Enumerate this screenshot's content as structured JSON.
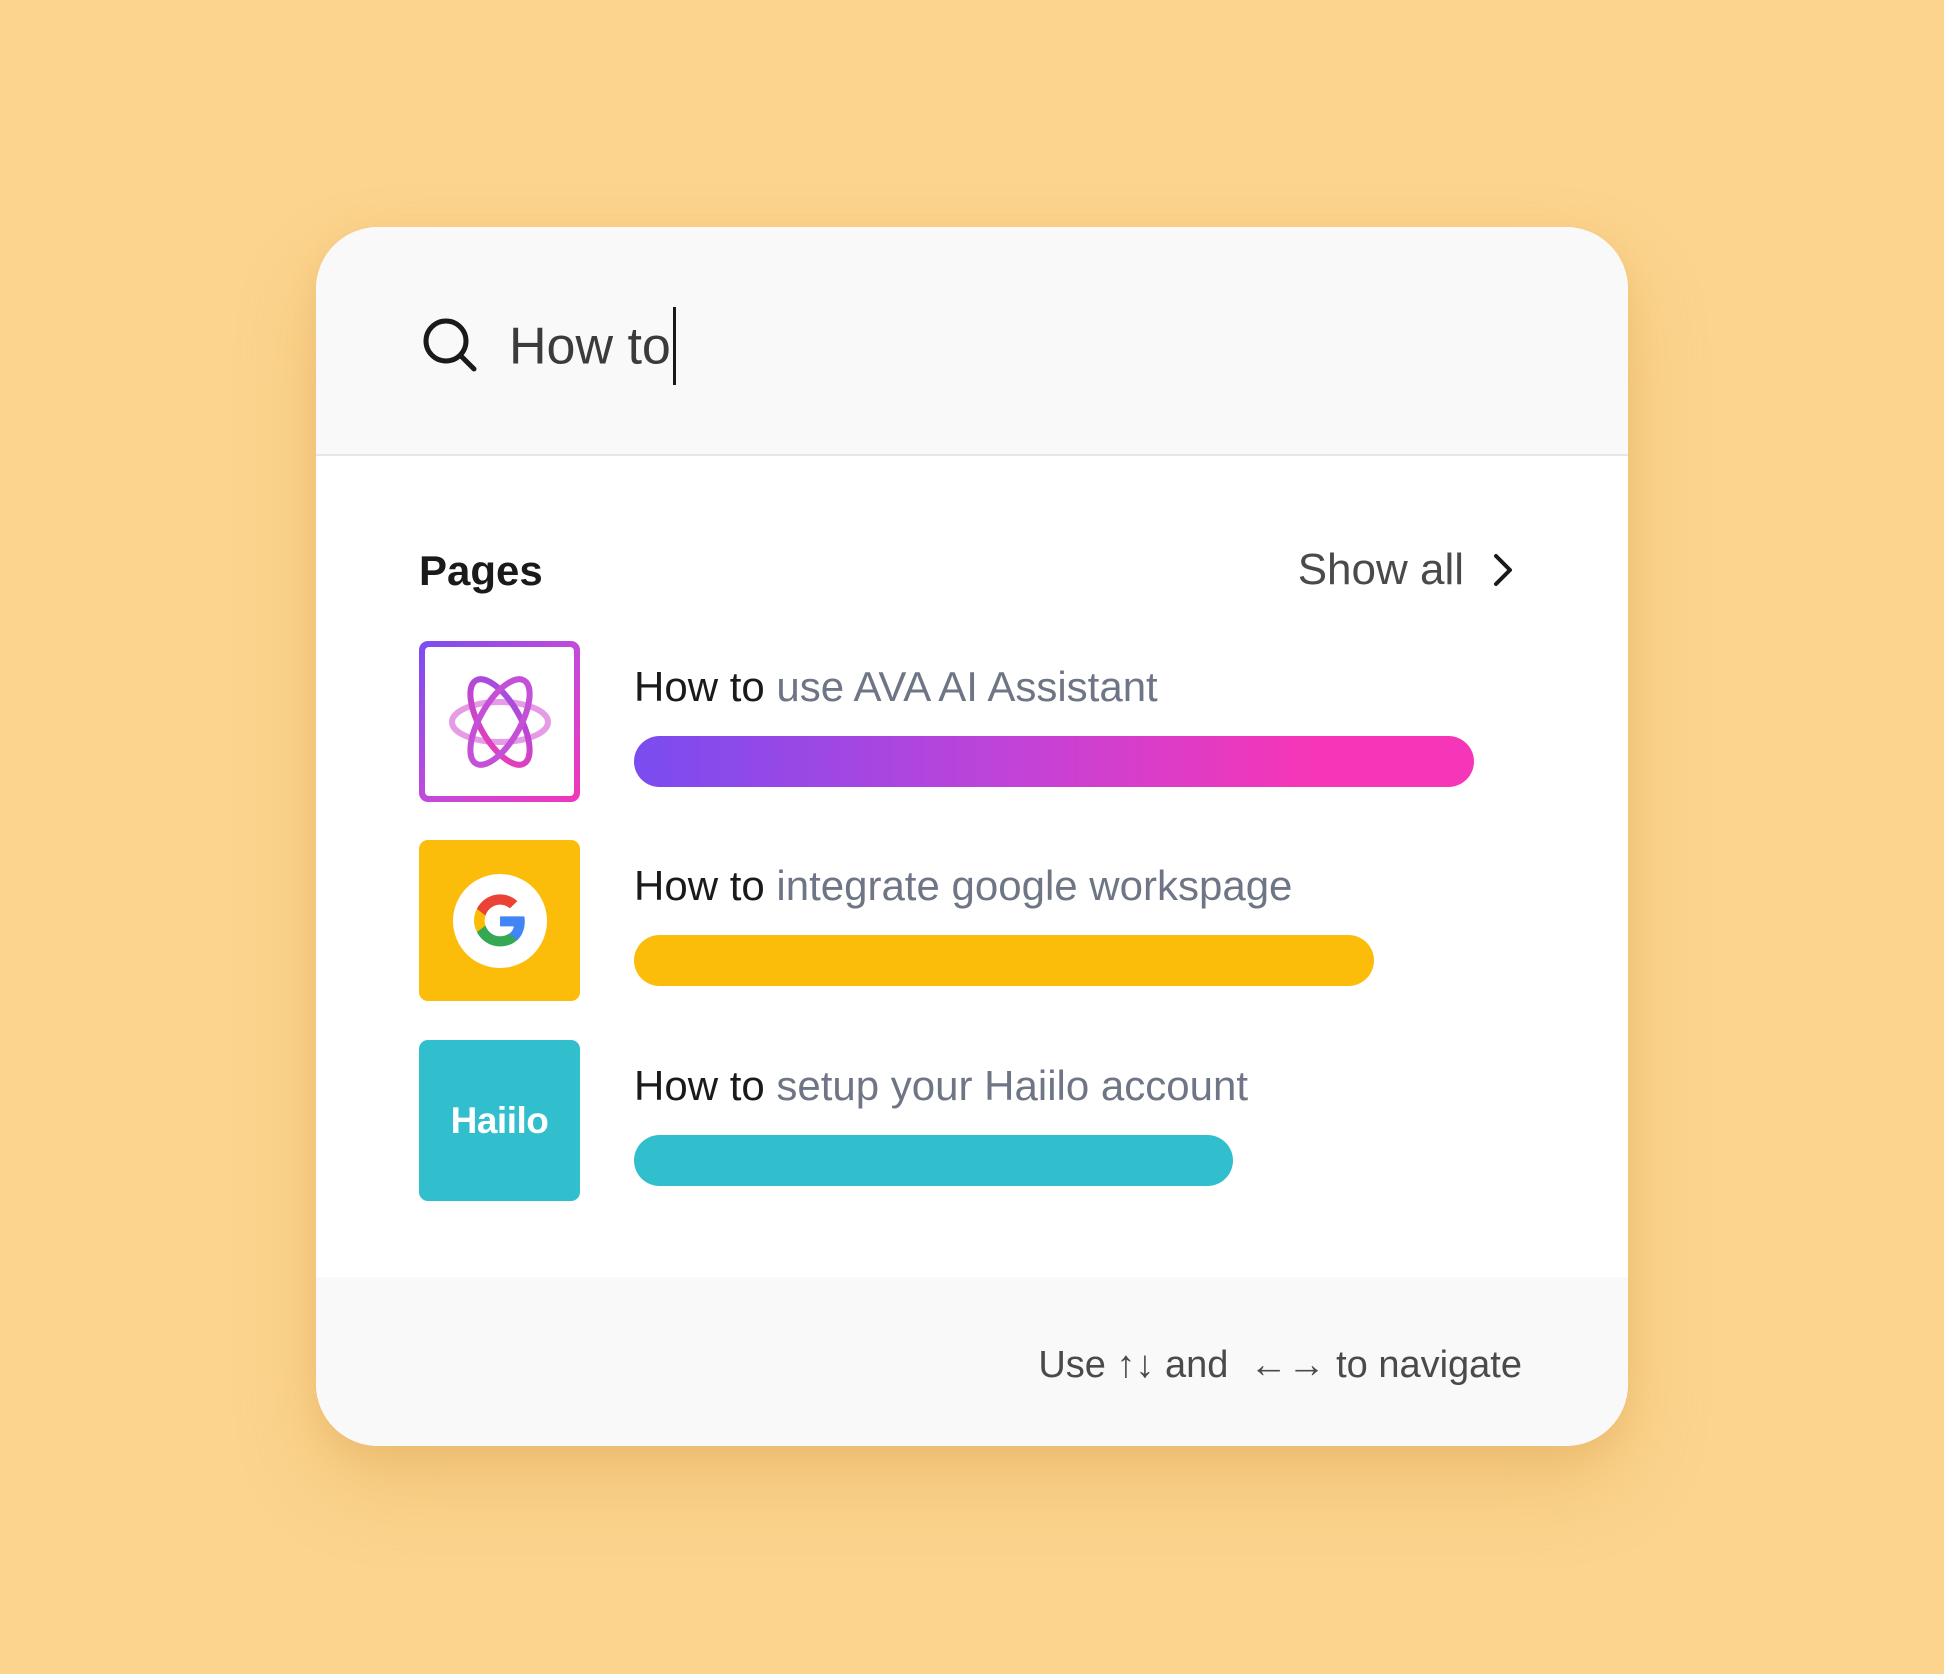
{
  "search": {
    "query": "How to"
  },
  "section": {
    "title": "Pages",
    "show_all_label": "Show all"
  },
  "results": [
    {
      "prefix": "How to",
      "rest": " use AVA AI Assistant",
      "icon": "ava-atom-icon",
      "bar_colors": [
        "#7a4cf0",
        "#f536b8"
      ]
    },
    {
      "prefix": "How to",
      "rest": " integrate google workspage",
      "icon": "google-icon",
      "bar_color": "#fbbc0a"
    },
    {
      "prefix": "How to",
      "rest": " setup your Haiilo account",
      "icon_text": "Haiilo",
      "bar_color": "#31bfcd"
    }
  ],
  "footer": {
    "hint": "Use ↑↓ and  ←→ to navigate"
  },
  "colors": {
    "background": "#fcd48e",
    "card": "#ffffff",
    "muted_text": "#6e7585"
  }
}
